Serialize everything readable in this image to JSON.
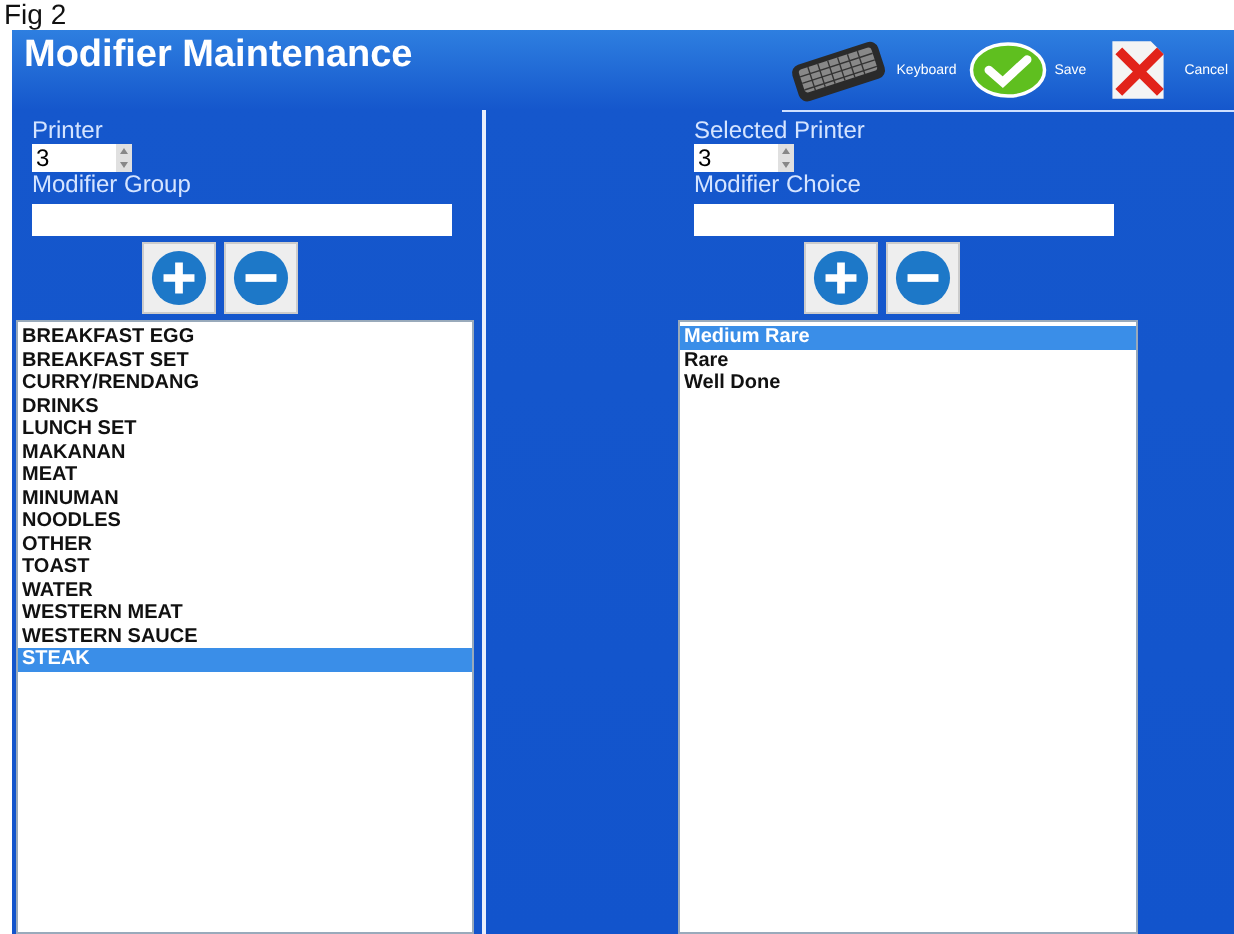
{
  "caption": "Fig 2",
  "window": {
    "title": "Modifier Maintenance"
  },
  "toolbar": [
    {
      "kind": "keyboard",
      "label": "Keyboard"
    },
    {
      "kind": "save",
      "label": "Save"
    },
    {
      "kind": "cancel",
      "label": "Cancel"
    }
  ],
  "left": {
    "printer_label": "Printer",
    "printer_value": "3",
    "group_label": "Modifier Group",
    "items": [
      {
        "label": "BREAKFAST EGG",
        "selected": false
      },
      {
        "label": "BREAKFAST SET",
        "selected": false
      },
      {
        "label": "CURRY/RENDANG",
        "selected": false
      },
      {
        "label": "DRINKS",
        "selected": false
      },
      {
        "label": "LUNCH SET",
        "selected": false
      },
      {
        "label": "MAKANAN",
        "selected": false
      },
      {
        "label": "MEAT",
        "selected": false
      },
      {
        "label": "MINUMAN",
        "selected": false
      },
      {
        "label": "NOODLES",
        "selected": false
      },
      {
        "label": "OTHER",
        "selected": false
      },
      {
        "label": "TOAST",
        "selected": false
      },
      {
        "label": "WATER",
        "selected": false
      },
      {
        "label": "WESTERN MEAT",
        "selected": false
      },
      {
        "label": "WESTERN SAUCE",
        "selected": false
      },
      {
        "label": "STEAK",
        "selected": true
      }
    ]
  },
  "right": {
    "printer_label": "Selected Printer",
    "printer_value": "3",
    "choice_label": "Modifier Choice",
    "items": [
      {
        "label": "Medium Rare",
        "selected": true
      },
      {
        "label": "Rare",
        "selected": false
      },
      {
        "label": "Well Done",
        "selected": false
      }
    ]
  }
}
